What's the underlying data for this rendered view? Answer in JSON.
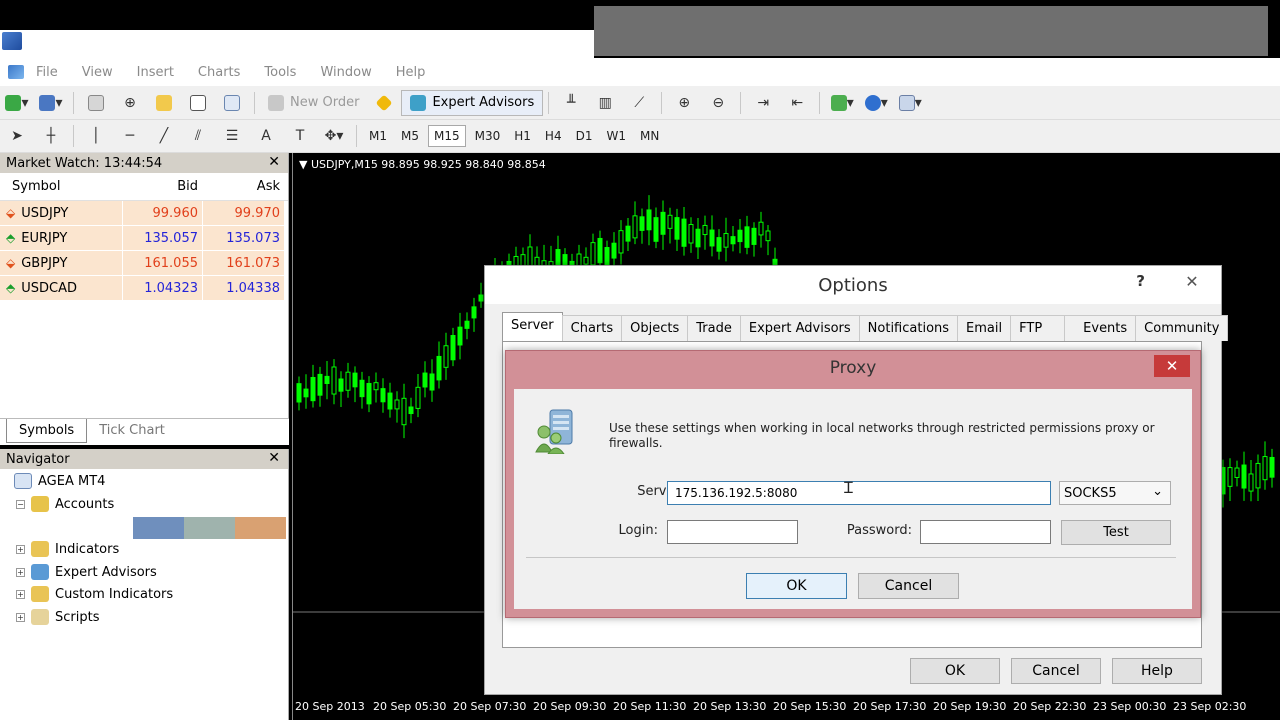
{
  "menu": {
    "items": [
      "File",
      "View",
      "Insert",
      "Charts",
      "Tools",
      "Window",
      "Help"
    ]
  },
  "toolbar": {
    "new_order_label": "New Order",
    "expert_advisors_label": "Expert Advisors",
    "timeframes": [
      "M1",
      "M5",
      "M15",
      "M30",
      "H1",
      "H4",
      "D1",
      "W1",
      "MN"
    ],
    "active_timeframe": "M15"
  },
  "market_watch": {
    "title": "Market Watch: 13:44:54",
    "columns": [
      "Symbol",
      "Bid",
      "Ask"
    ],
    "rows": [
      {
        "symbol": "USDJPY",
        "bid": "99.960",
        "ask": "99.970",
        "direction": "down"
      },
      {
        "symbol": "EURJPY",
        "bid": "135.057",
        "ask": "135.073",
        "direction": "up"
      },
      {
        "symbol": "GBPJPY",
        "bid": "161.055",
        "ask": "161.073",
        "direction": "down"
      },
      {
        "symbol": "USDCAD",
        "bid": "1.04323",
        "ask": "1.04338",
        "direction": "up"
      }
    ],
    "tabs": [
      "Symbols",
      "Tick Chart"
    ]
  },
  "navigator": {
    "title": "Navigator",
    "root": "AGEA MT4",
    "items": [
      "Accounts",
      "Indicators",
      "Expert Advisors",
      "Custom Indicators",
      "Scripts"
    ],
    "account_colors": [
      "#6f8fbd",
      "#9fb3ad",
      "#d9a172"
    ]
  },
  "chart": {
    "label": "USDJPY,M15  98.895 98.925 98.840 98.854",
    "x_ticks": [
      "20 Sep 2013",
      "20 Sep 05:30",
      "20 Sep 07:30",
      "20 Sep 09:30",
      "20 Sep 11:30",
      "20 Sep 13:30",
      "20 Sep 15:30",
      "20 Sep 17:30",
      "20 Sep 19:30",
      "20 Sep 22:30",
      "23 Sep 00:30",
      "23 Sep 02:30"
    ],
    "candle_color": "#00ff00"
  },
  "options": {
    "title": "Options",
    "help_glyph": "?",
    "tabs": [
      "Server",
      "Charts",
      "Objects",
      "Trade",
      "Expert Advisors",
      "Notifications",
      "Email",
      "FTP",
      "Events",
      "Community"
    ],
    "active_tab": "Server",
    "ok": "OK",
    "cancel": "Cancel",
    "help": "Help"
  },
  "proxy": {
    "title": "Proxy",
    "description": "Use these settings when working in local networks through restricted permissions proxy or firewalls.",
    "server_label": "Server:",
    "server_value": "175.136.192.5:8080",
    "type_value": "SOCKS5",
    "login_label": "Login:",
    "login_value": "",
    "password_label": "Password:",
    "password_value": "",
    "test": "Test",
    "ok": "OK",
    "cancel": "Cancel"
  }
}
